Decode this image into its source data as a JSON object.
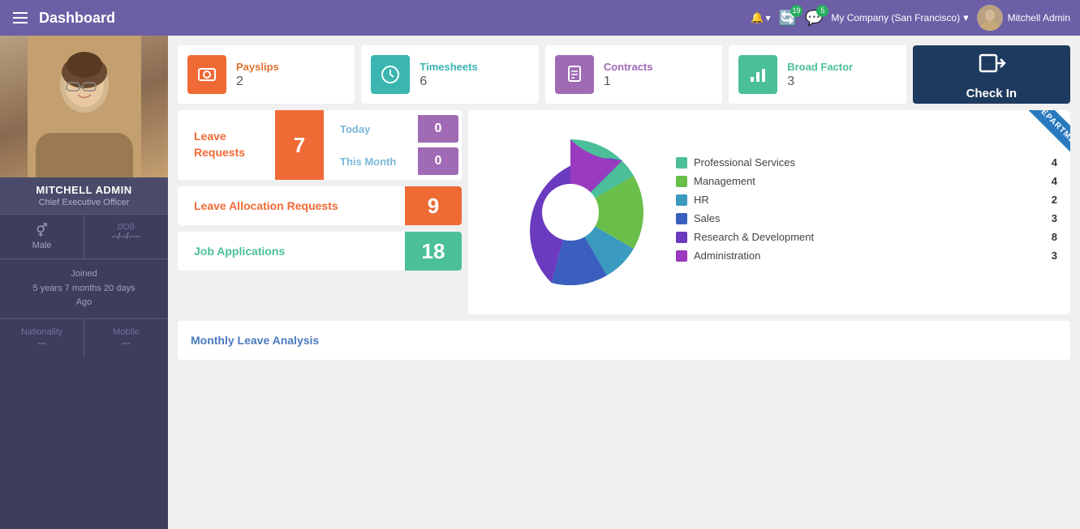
{
  "topnav": {
    "title": "Dashboard",
    "alert_count": "",
    "activity_count": "19",
    "message_count": "5",
    "company": "My Company (San Francisco)",
    "user": "Mitchell Admin"
  },
  "tiles": {
    "payslips": {
      "label": "Payslips",
      "count": "2"
    },
    "timesheets": {
      "label": "Timesheets",
      "count": "6"
    },
    "contracts": {
      "label": "Contracts",
      "count": "1"
    },
    "broad_factor": {
      "label": "Broad Factor",
      "count": "3"
    },
    "checkin": {
      "label": "Check In"
    }
  },
  "sidebar": {
    "name": "MITCHELL ADMIN",
    "title": "Chief Executive Officer",
    "gender": "Male",
    "dob_label": "DOB",
    "dob_value": "--/--/----",
    "joined_label": "Joined",
    "joined_value": "5 years 7 months 20 days",
    "joined_suffix": "Ago",
    "nationality_label": "Nationality",
    "nationality_value": "---",
    "mobile_label": "Mobile",
    "mobile_value": "---"
  },
  "leave_requests": {
    "label": "Leave\nRequests",
    "count": "7",
    "today_label": "Today",
    "today_count": "0",
    "month_label": "This Month",
    "month_count": "0"
  },
  "leave_allocation": {
    "label": "Leave Allocation Requests",
    "count": "9"
  },
  "job_applications": {
    "label": "Job Applications",
    "count": "18"
  },
  "departments": {
    "ribbon": "DEPARTMENTS",
    "legend": [
      {
        "name": "Professional Services",
        "count": "4",
        "color": "#4abf9a"
      },
      {
        "name": "Management",
        "count": "4",
        "color": "#6abf4a"
      },
      {
        "name": "HR",
        "count": "2",
        "color": "#3a9abf"
      },
      {
        "name": "Sales",
        "count": "3",
        "color": "#3a5fbf"
      },
      {
        "name": "Research & Development",
        "count": "8",
        "color": "#6a3abf"
      },
      {
        "name": "Administration",
        "count": "3",
        "color": "#9a3abf"
      }
    ]
  },
  "monthly_analysis": {
    "title": "Monthly Leave Analysis"
  }
}
